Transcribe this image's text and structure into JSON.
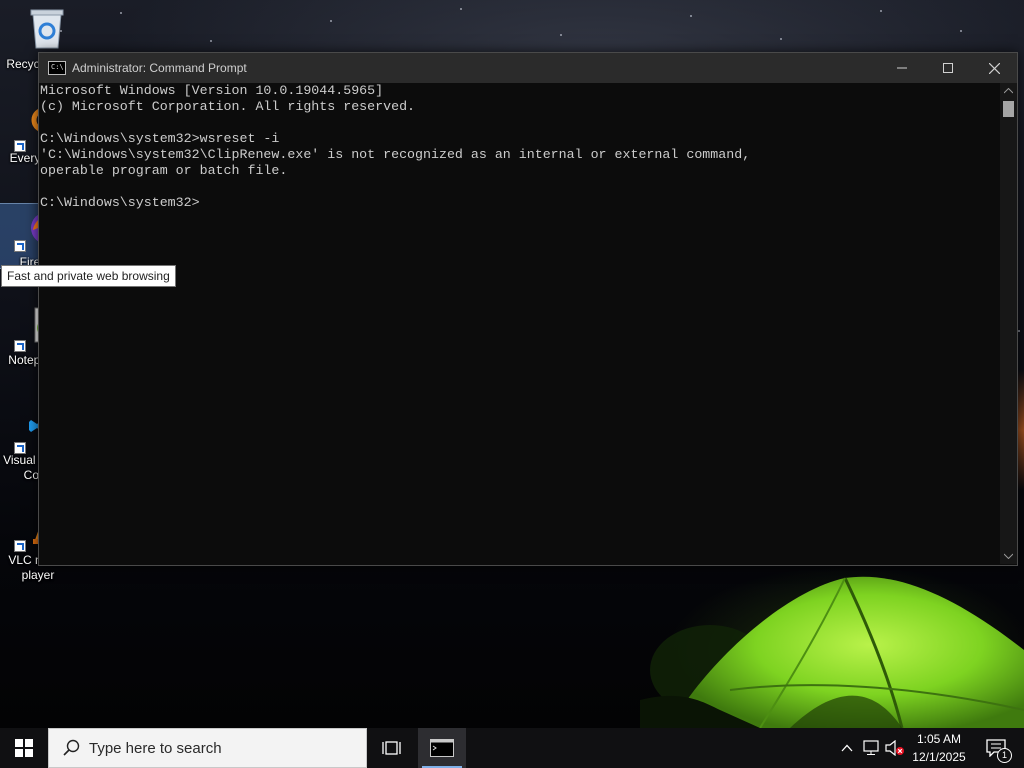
{
  "desktop": {
    "icons": [
      {
        "label": "Recycle Bin",
        "icon": "recycle-bin-icon"
      },
      {
        "label": "Everything",
        "icon": "everything-search-icon"
      },
      {
        "label": "Firefox",
        "icon": "firefox-icon"
      },
      {
        "label": "Notepad++",
        "icon": "notepad-plus-plus-icon"
      },
      {
        "label": "Visual Studio Code",
        "icon": "vscode-icon"
      },
      {
        "label": "VLC media player",
        "icon": "vlc-icon"
      }
    ],
    "tooltip": "Fast and private web browsing"
  },
  "window": {
    "title": "Administrator: Command Prompt",
    "icon": "command-prompt-icon",
    "app_icon_text": "C:\\",
    "console_lines": [
      "Microsoft Windows [Version 10.0.19044.5965]",
      "(c) Microsoft Corporation. All rights reserved.",
      "",
      "C:\\Windows\\system32>wsreset -i",
      "'C:\\Windows\\system32\\ClipRenew.exe' is not recognized as an internal or external command,",
      "operable program or batch file.",
      "",
      "C:\\Windows\\system32>"
    ]
  },
  "taskbar": {
    "search_placeholder": "Type here to search",
    "pinned": [
      {
        "name": "task-view",
        "icon": "task-view-icon"
      },
      {
        "name": "command-prompt",
        "icon": "command-prompt-icon",
        "active": true
      }
    ],
    "tray": {
      "icons": [
        "chevron-up-icon",
        "network-icon",
        "volume-muted-icon"
      ],
      "time": "1:05 AM",
      "date": "12/1/2025",
      "notification_count": "1"
    }
  },
  "colors": {
    "console_bg": "#0c0c0c",
    "console_text": "#cccccc",
    "titlebar": "#2b2b2b",
    "taskbar": "#101012",
    "tent_green": "#7ed321"
  }
}
